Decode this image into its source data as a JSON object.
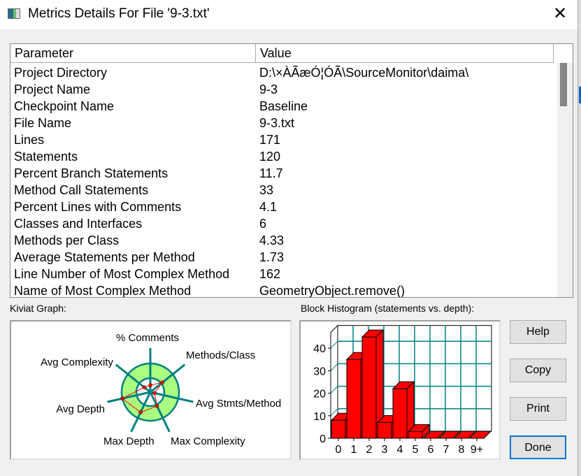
{
  "window": {
    "title": "Metrics Details For File '9-3.txt'",
    "close_glyph": "✕"
  },
  "table": {
    "headers": [
      "Parameter",
      "Value"
    ],
    "rows": [
      [
        "Project Directory",
        "D:\\×ÀÃæÓ¦ÓÃ\\SourceMonitor\\daima\\"
      ],
      [
        "Project Name",
        "9-3"
      ],
      [
        "Checkpoint Name",
        "Baseline"
      ],
      [
        "File Name",
        "9-3.txt"
      ],
      [
        "Lines",
        "171"
      ],
      [
        "Statements",
        "120"
      ],
      [
        "Percent Branch Statements",
        "11.7"
      ],
      [
        "Method Call Statements",
        "33"
      ],
      [
        "Percent Lines with Comments",
        "4.1"
      ],
      [
        "Classes and Interfaces",
        "6"
      ],
      [
        "Methods per Class",
        "4.33"
      ],
      [
        "Average Statements per Method",
        "1.73"
      ],
      [
        "Line Number of Most Complex Method",
        "162"
      ],
      [
        "Name of Most Complex Method",
        "GeometryObject.remove()"
      ]
    ]
  },
  "kiviat": {
    "label": "Kiviat Graph:",
    "axes": [
      "% Comments",
      "Methods/Class",
      "Avg Stmts/Method",
      "Max Complexity",
      "Max Depth",
      "Avg Depth",
      "Avg Complexity"
    ],
    "levels": [
      0.24,
      0.54,
      0.15,
      0.54,
      0.78,
      1.0,
      0.27
    ],
    "colors": {
      "band": "#aaff80",
      "spoke": "#008080",
      "line": "#ff0000"
    }
  },
  "histogram": {
    "label": "Block Histogram (statements vs. depth):",
    "chart_data": {
      "type": "bar",
      "categories": [
        "0",
        "1",
        "2",
        "3",
        "4",
        "5",
        "6",
        "7",
        "8",
        "9+"
      ],
      "values": [
        8,
        35,
        45,
        7,
        22,
        3,
        0,
        0,
        0,
        0
      ],
      "yticks": [
        0,
        10,
        20,
        30,
        40
      ],
      "ylim": [
        0,
        47
      ],
      "grid": true,
      "colors": {
        "bar": "#ff0000",
        "grid": "#008080"
      }
    }
  },
  "buttons": {
    "help": "Help",
    "copy": "Copy",
    "print": "Print",
    "done": "Done"
  }
}
